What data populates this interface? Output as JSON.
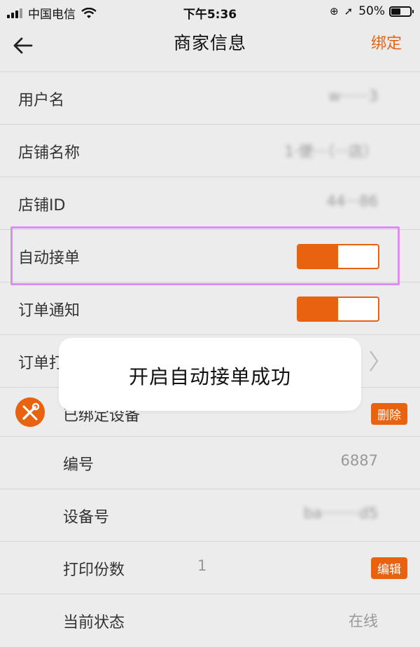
{
  "status_bar": {
    "carrier": "中国电信",
    "time": "下午5:36",
    "battery": "50%",
    "battery_level": 0.5
  },
  "nav": {
    "title": "商家信息",
    "action": "绑定"
  },
  "rows": {
    "username": {
      "label": "用户名",
      "value": "w······3"
    },
    "shop_name": {
      "label": "店铺名称",
      "value": "1·便···（···店）"
    },
    "shop_id": {
      "label": "店铺ID",
      "value": "44···86"
    },
    "auto_accept": {
      "label": "自动接单",
      "on": true
    },
    "order_notify": {
      "label": "订单通知",
      "on": true
    },
    "order_partial": {
      "label": "订单打"
    },
    "bound_device": {
      "label": "已绑定设备",
      "tag": "删除"
    },
    "serial": {
      "label": "编号",
      "value": "6887"
    },
    "device_no": {
      "label": "设备号",
      "value": "ba········d5"
    },
    "copies": {
      "label": "打印份数",
      "value": "1",
      "tag": "编辑"
    },
    "state": {
      "label": "当前状态",
      "value": "在线"
    }
  },
  "toast": {
    "text": "开启自动接单成功"
  },
  "colors": {
    "accent": "#e8620f",
    "highlight": "#d98ef0"
  }
}
